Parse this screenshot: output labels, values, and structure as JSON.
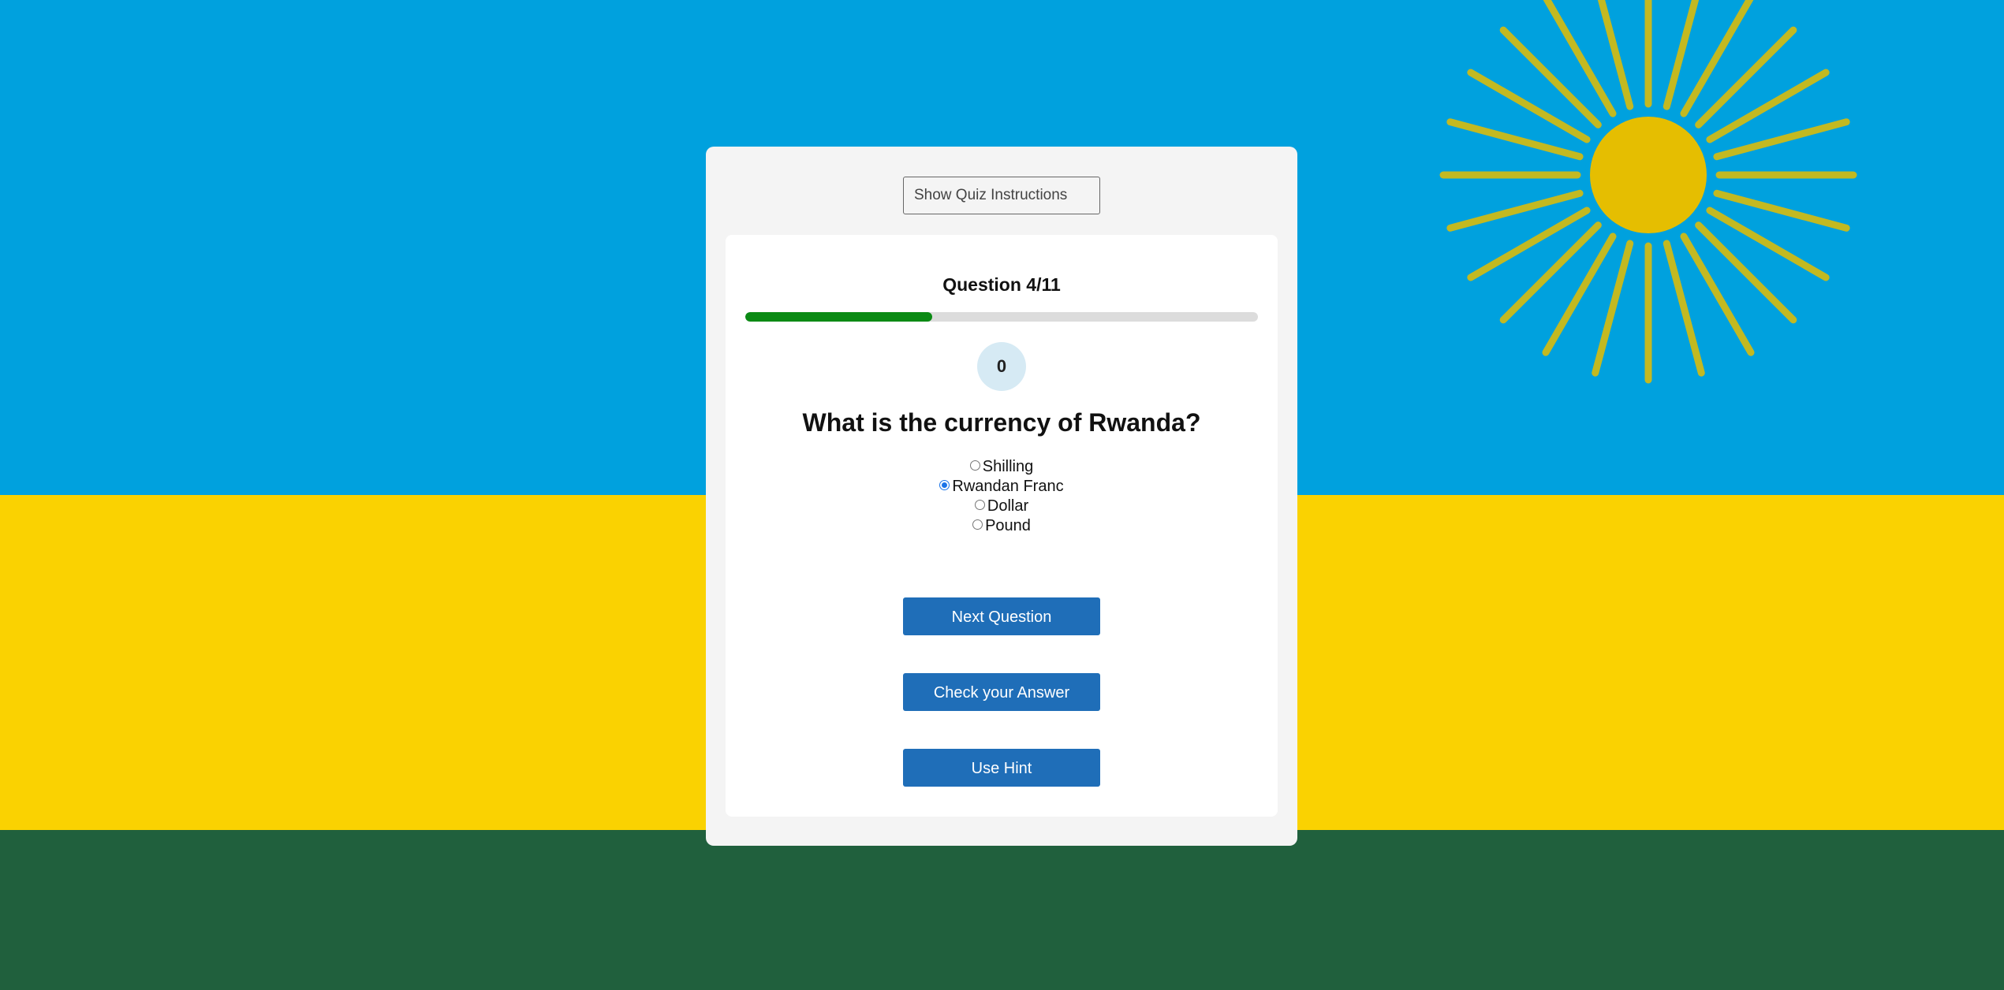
{
  "background": {
    "colors": {
      "blue": "#00a1de",
      "yellow": "#fad201",
      "green": "#20603d",
      "sun": "#e5be01"
    }
  },
  "instructions_button": {
    "label": "Show Quiz Instructions"
  },
  "quiz": {
    "counter": "Question 4/11",
    "progress_fraction": 0.364,
    "score": "0",
    "question": "What is the currency of Rwanda?",
    "options": [
      {
        "label": "Shilling",
        "checked": false
      },
      {
        "label": "Rwandan Franc",
        "checked": true
      },
      {
        "label": "Dollar",
        "checked": false
      },
      {
        "label": "Pound",
        "checked": false
      }
    ],
    "buttons": {
      "next": "Next Question",
      "check": "Check your Answer",
      "hint": "Use Hint"
    }
  },
  "colors": {
    "accent": "#1f6eb8",
    "progress": "#0b8a14",
    "score_bg": "#d6eaf4"
  }
}
